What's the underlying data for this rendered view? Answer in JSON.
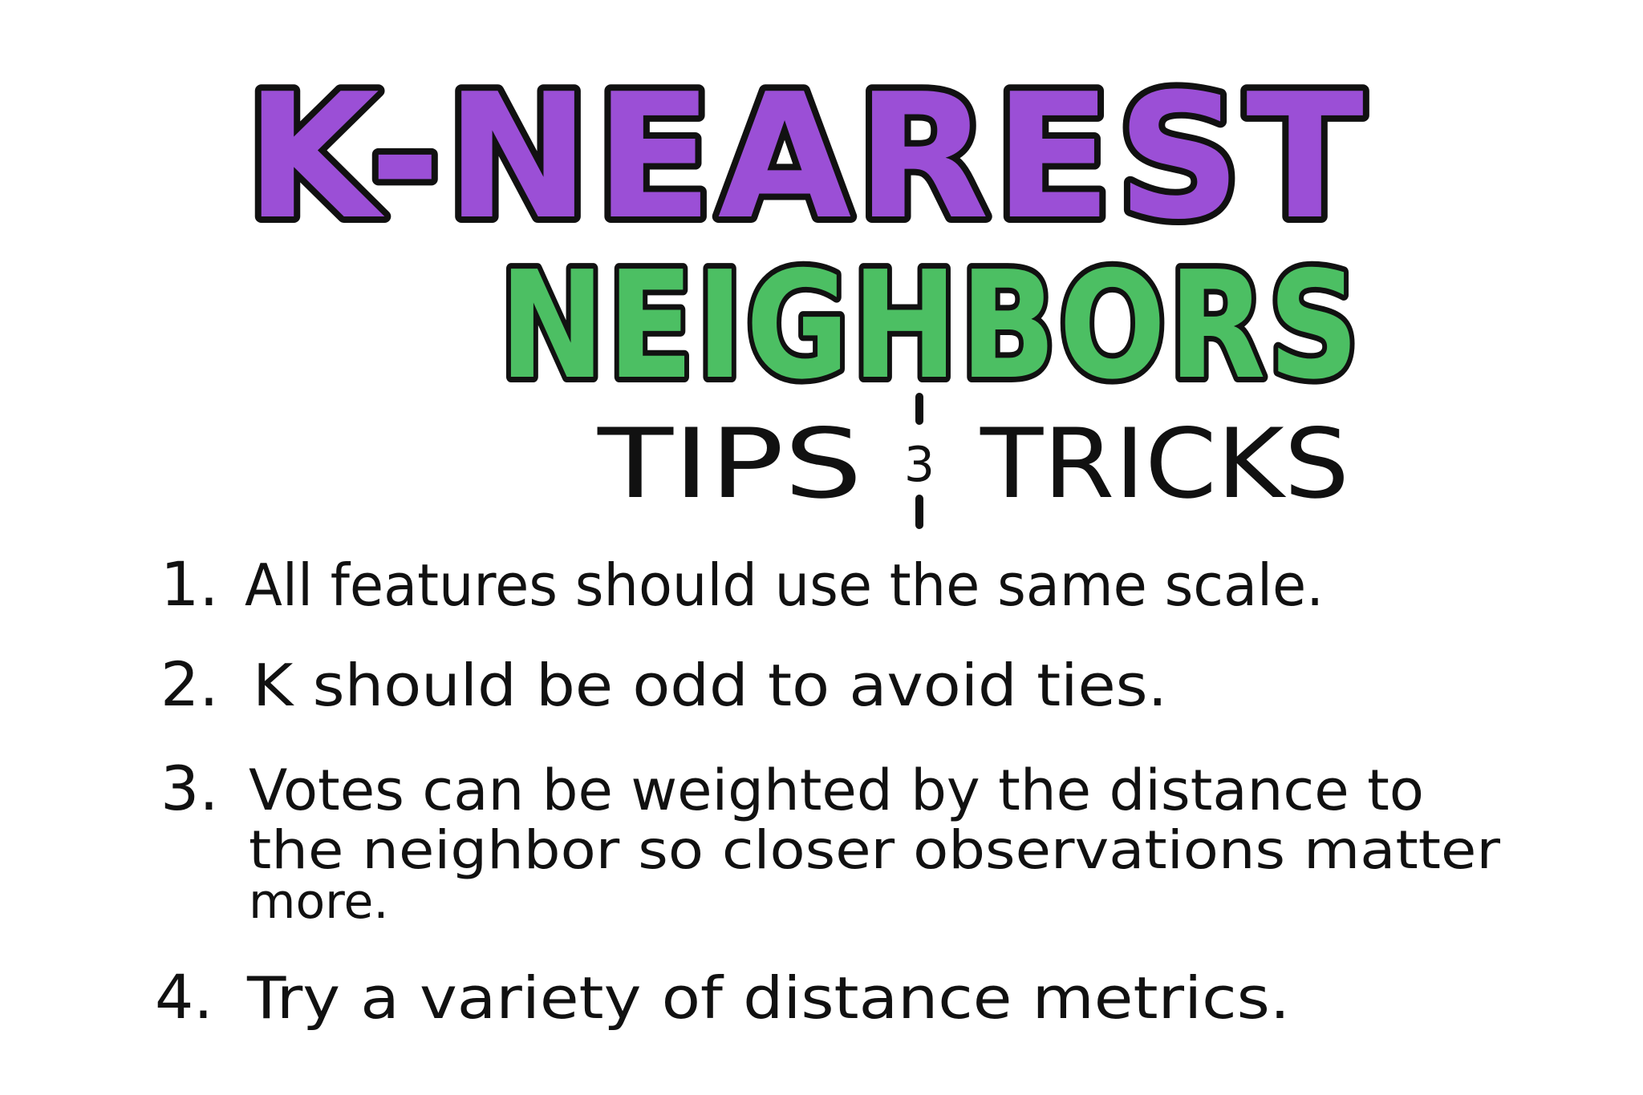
{
  "title": {
    "line1": "K-NEAREST",
    "line2": "NEIGHBORS",
    "subtitle_left": "TIPS",
    "subtitle_amp": "3",
    "subtitle_right": "TRICKS"
  },
  "tips": [
    {
      "number": "1.",
      "lines": [
        "All features should use the same scale."
      ]
    },
    {
      "number": "2.",
      "lines": [
        "K should be odd to avoid ties."
      ]
    },
    {
      "number": "3.",
      "lines": [
        "Votes can be weighted by the distance to",
        "the neighbor so closer observations matter",
        "more."
      ]
    },
    {
      "number": "4.",
      "lines": [
        "Try a variety of distance metrics."
      ]
    }
  ],
  "colors": {
    "purple_fill": "#9b4fd6",
    "purple_highlight": "#c58cf5",
    "green_fill": "#4cbf63",
    "green_highlight": "#86e88f",
    "ink": "#111111",
    "background": "#ffffff"
  }
}
